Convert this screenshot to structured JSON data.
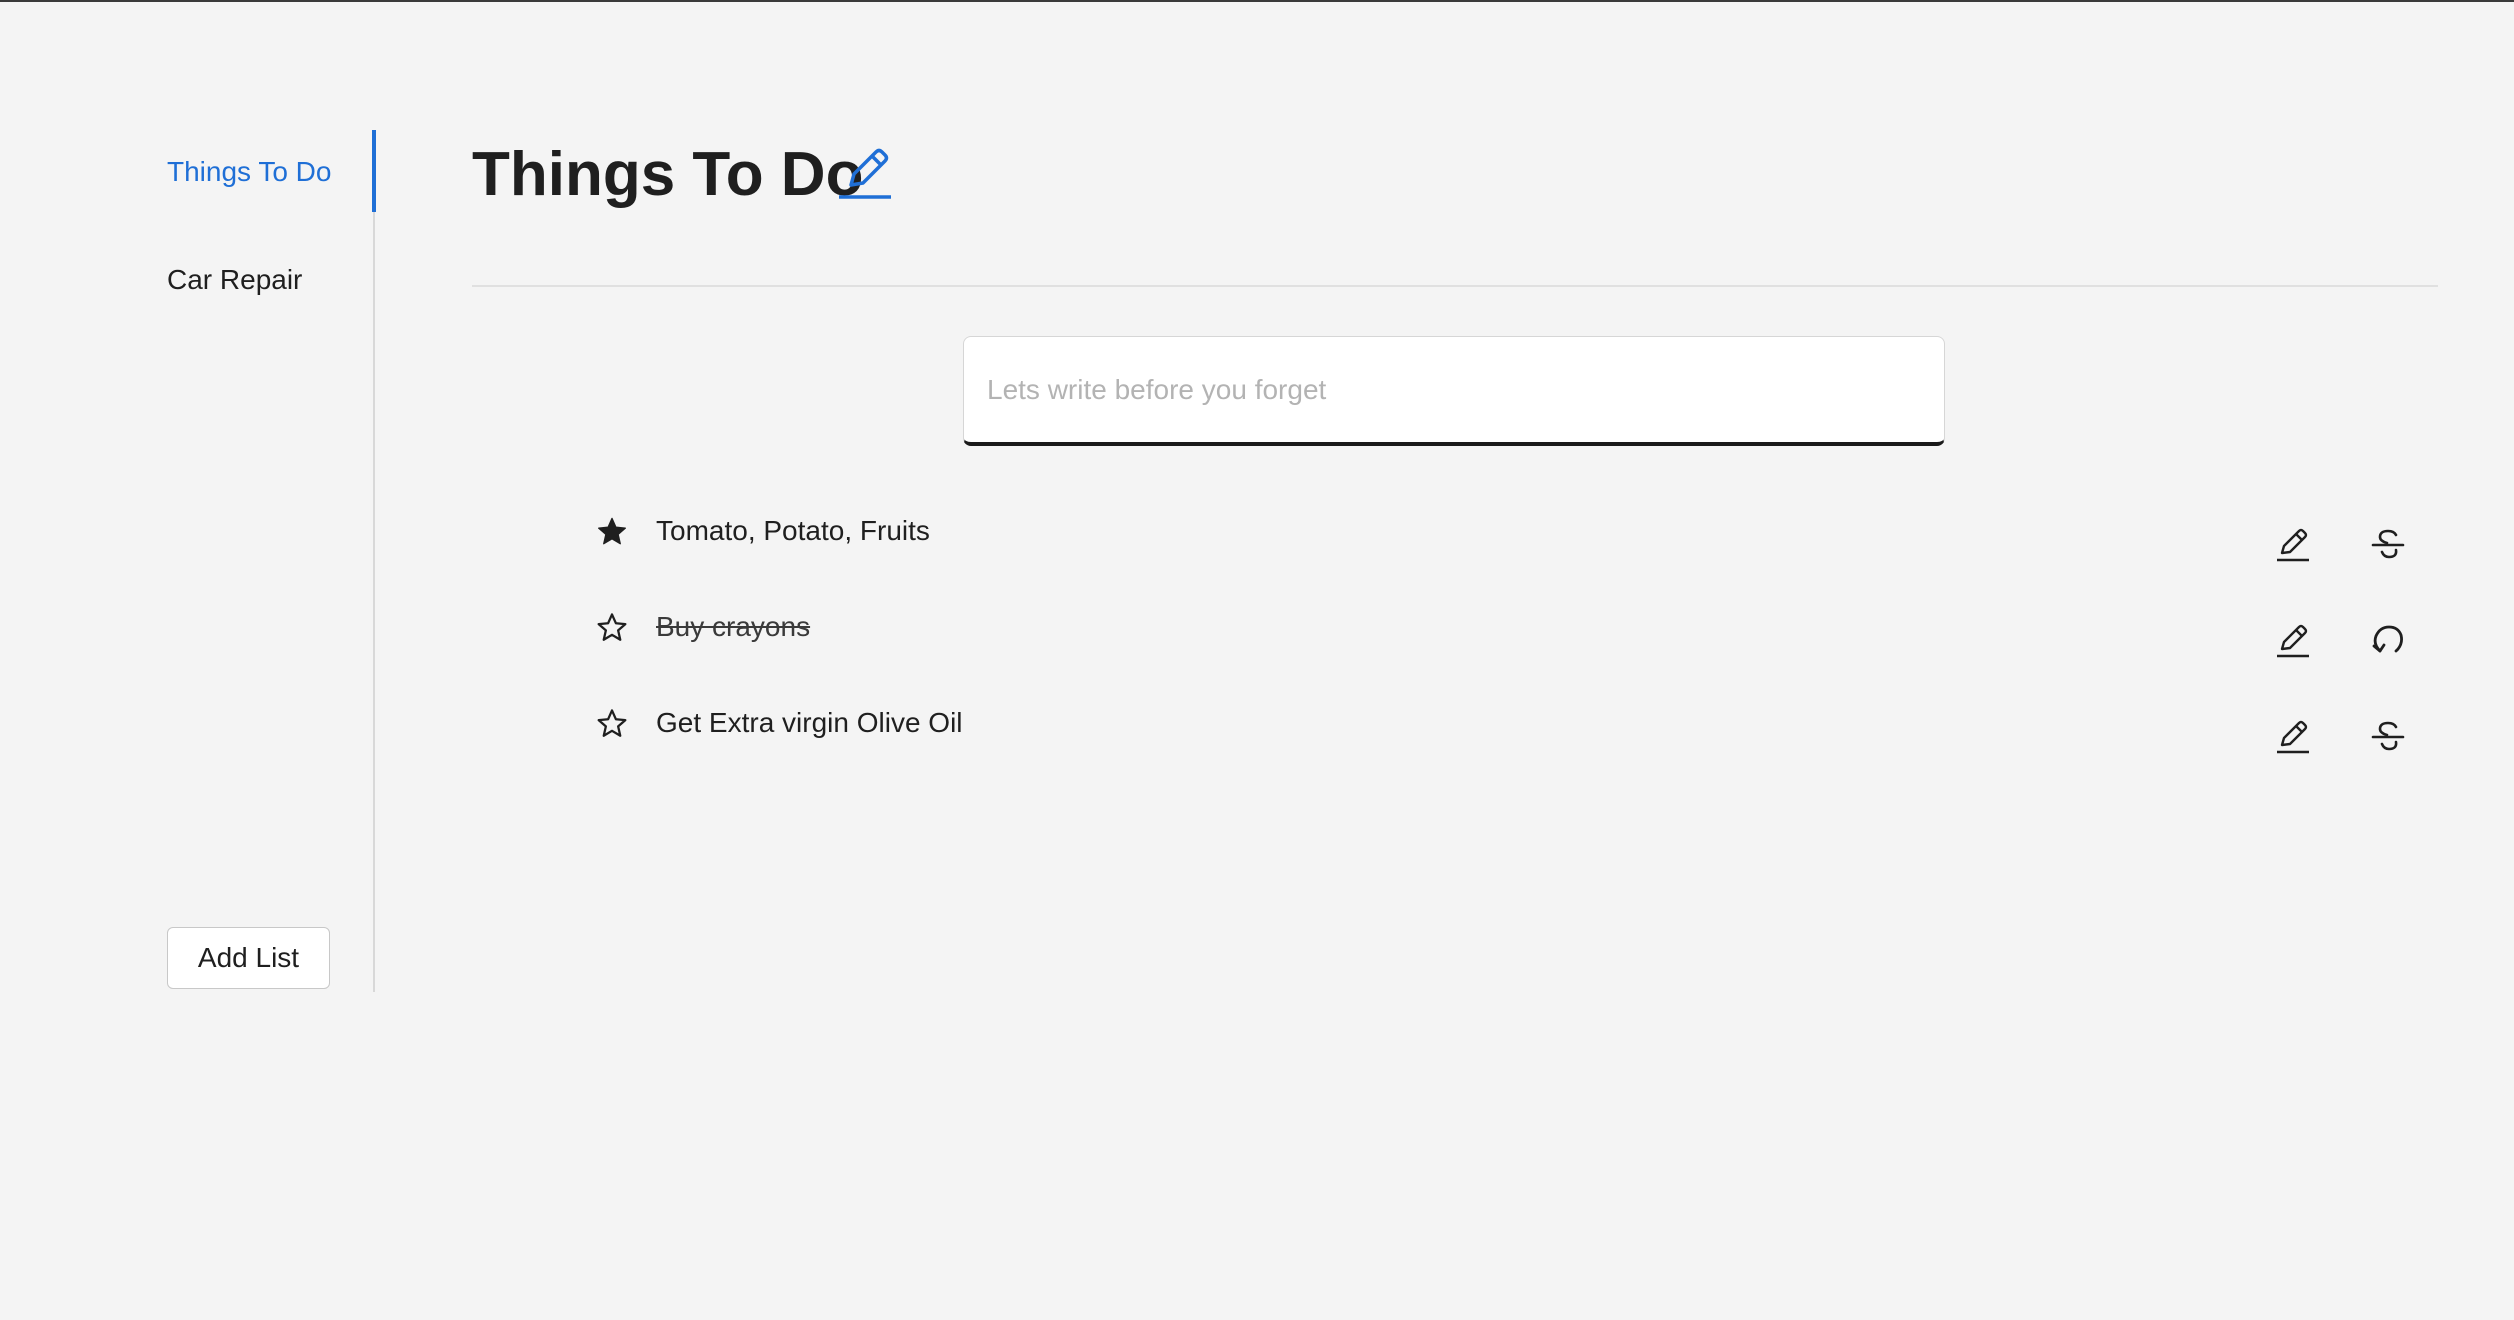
{
  "sidebar": {
    "items": [
      {
        "label": "Things To Do",
        "active": true
      },
      {
        "label": "Car Repair",
        "active": false
      }
    ],
    "add_list_label": "Add List"
  },
  "header": {
    "title": "Things To Do",
    "edit_icon": "pencil-icon"
  },
  "composer": {
    "value": "",
    "placeholder": "Lets write before you forget"
  },
  "todos": [
    {
      "text": "Tomato, Potato, Fruits",
      "starred": true,
      "completed": false,
      "actions": [
        "pencil-icon",
        "strikethrough-icon"
      ]
    },
    {
      "text": "Buy crayons",
      "starred": false,
      "completed": true,
      "actions": [
        "pencil-icon",
        "undo-icon"
      ]
    },
    {
      "text": "Get Extra virgin Olive Oil",
      "starred": false,
      "completed": false,
      "actions": [
        "pencil-icon",
        "strikethrough-icon"
      ]
    }
  ],
  "colors": {
    "accent": "#1f6fd6",
    "background": "#f4f4f4",
    "text": "#1f1f1f",
    "input_underline": "#1a1a1a"
  }
}
